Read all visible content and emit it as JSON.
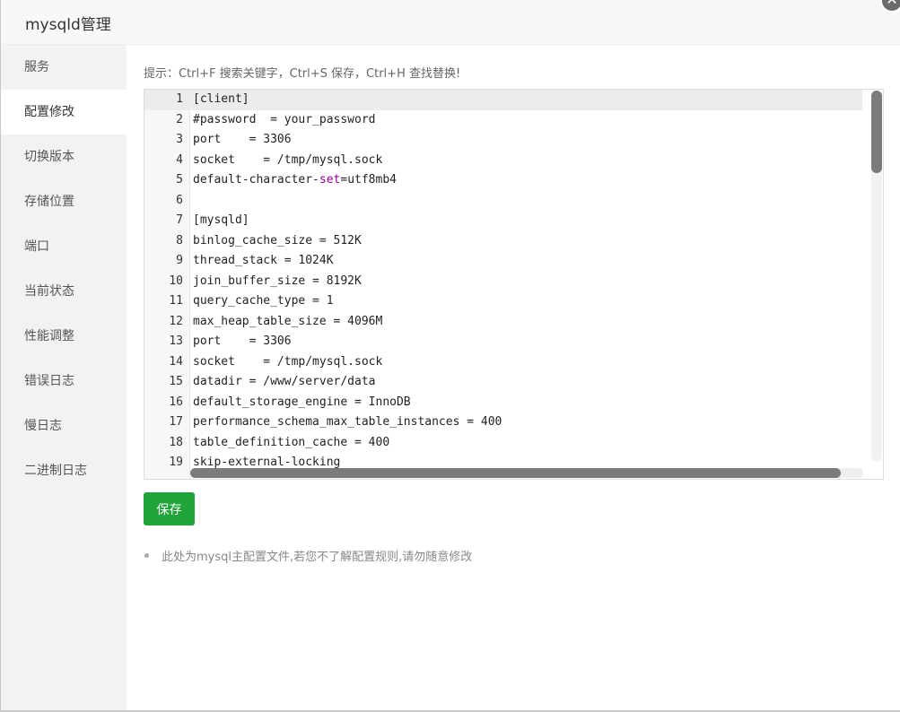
{
  "dialog": {
    "title": "mysqld管理",
    "close_glyph": "✕"
  },
  "sidebar": {
    "items": [
      {
        "label": "服务",
        "active": false
      },
      {
        "label": "配置修改",
        "active": true
      },
      {
        "label": "切换版本",
        "active": false
      },
      {
        "label": "存储位置",
        "active": false
      },
      {
        "label": "端口",
        "active": false
      },
      {
        "label": "当前状态",
        "active": false
      },
      {
        "label": "性能调整",
        "active": false
      },
      {
        "label": "错误日志",
        "active": false
      },
      {
        "label": "慢日志",
        "active": false
      },
      {
        "label": "二进制日志",
        "active": false
      }
    ]
  },
  "main": {
    "tip": "提示：Ctrl+F 搜索关键字，Ctrl+S 保存，Ctrl+H 查找替换!",
    "editor": {
      "lines": [
        {
          "n": "1",
          "text": "[client]"
        },
        {
          "n": "2",
          "text": "#password  = your_password"
        },
        {
          "n": "3",
          "text": "port    = 3306"
        },
        {
          "n": "4",
          "text": "socket    = /tmp/mysql.sock"
        },
        {
          "n": "5",
          "text": "default-character-set=utf8mb4"
        },
        {
          "n": "6",
          "text": ""
        },
        {
          "n": "7",
          "text": "[mysqld]"
        },
        {
          "n": "8",
          "text": "binlog_cache_size = 512K"
        },
        {
          "n": "9",
          "text": "thread_stack = 1024K"
        },
        {
          "n": "10",
          "text": "join_buffer_size = 8192K"
        },
        {
          "n": "11",
          "text": "query_cache_type = 1"
        },
        {
          "n": "12",
          "text": "max_heap_table_size = 4096M"
        },
        {
          "n": "13",
          "text": "port    = 3306"
        },
        {
          "n": "14",
          "text": "socket    = /tmp/mysql.sock"
        },
        {
          "n": "15",
          "text": "datadir = /www/server/data"
        },
        {
          "n": "16",
          "text": "default_storage_engine = InnoDB"
        },
        {
          "n": "17",
          "text": "performance_schema_max_table_instances = 400"
        },
        {
          "n": "18",
          "text": "table_definition_cache = 400"
        },
        {
          "n": "19",
          "text": "skip-external-locking"
        }
      ]
    },
    "save_label": "保存",
    "note": "此处为mysql主配置文件,若您不了解配置规则,请勿随意修改"
  },
  "colors": {
    "accent_green": "#20a53a",
    "comment_green": "#2a7d2a",
    "keyword_purple": "#990099"
  }
}
